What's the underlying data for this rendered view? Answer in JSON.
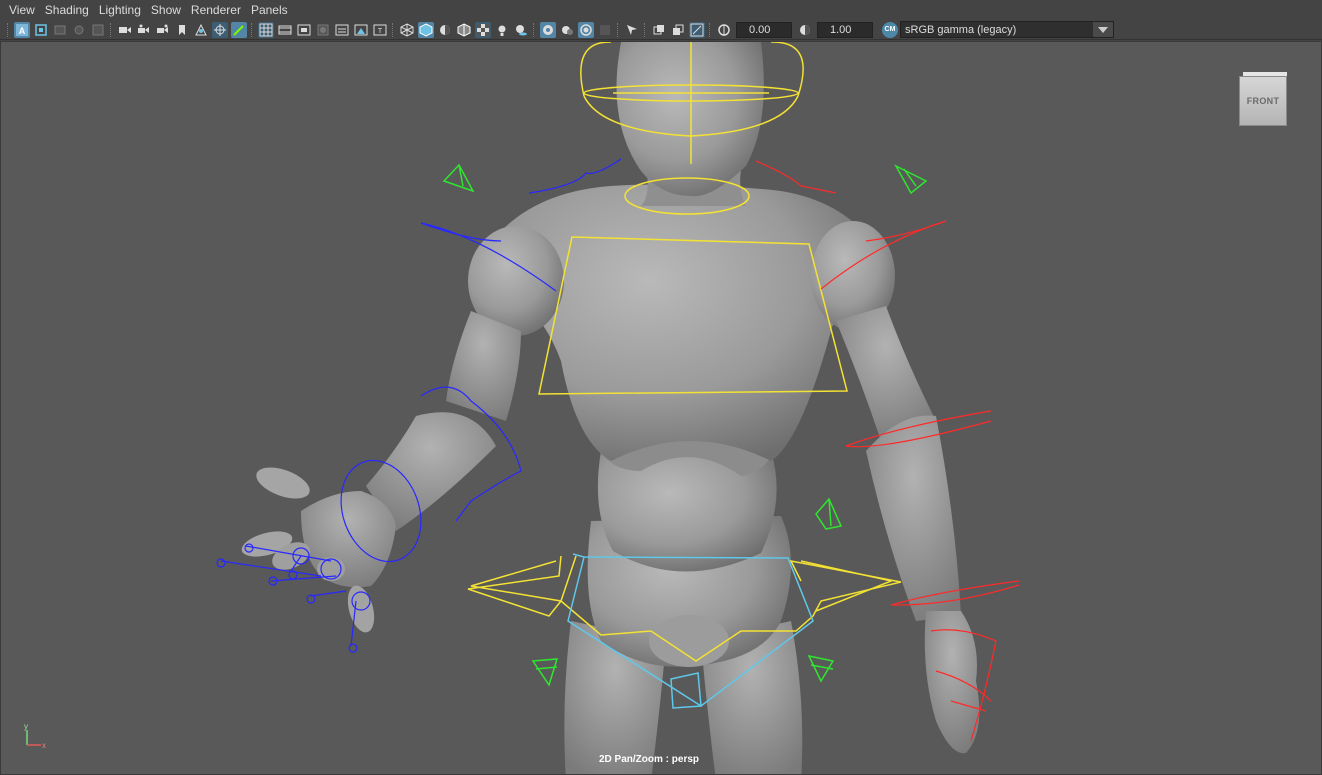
{
  "menubar": {
    "items": [
      "View",
      "Shading",
      "Lighting",
      "Show",
      "Renderer",
      "Panels"
    ]
  },
  "toolbar": {
    "exposure_value": "0.00",
    "gamma_value": "1.00",
    "color_management_badge": "CM",
    "view_transform": "sRGB gamma (legacy)"
  },
  "viewport": {
    "camera_status": "2D Pan/Zoom : persp",
    "viewcube_face": "FRONT",
    "axis_label_y": "y",
    "axis_label_x": "x"
  },
  "colors": {
    "viewport_bg": "#595959",
    "ui_bg": "#444444",
    "accent": "#5285a6",
    "control_yellow": "#f3e234",
    "control_blue": "#2828ff",
    "control_red": "#ff2a2a",
    "control_green": "#2ee62e",
    "control_cyan": "#5fc8ea"
  },
  "icons": [
    "select-camera-icon",
    "camera-attributes-icon",
    "bookmark-icon",
    "image-plane-icon",
    "grid-icon",
    "film-gate-icon",
    "resolution-gate-icon",
    "safe-action-icon",
    "wireframe-icon",
    "smooth-shade-icon",
    "textured-icon",
    "lights-icon",
    "shadows-icon",
    "isolate-select-icon",
    "xray-icon",
    "gamma-icon"
  ]
}
